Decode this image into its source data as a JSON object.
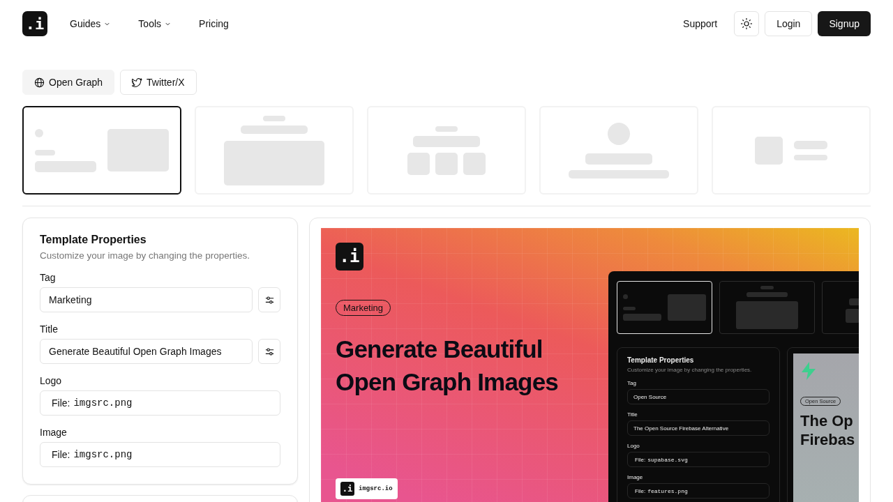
{
  "nav": {
    "logo": ".i",
    "menu": [
      {
        "label": "Guides",
        "dropdown": true
      },
      {
        "label": "Tools",
        "dropdown": true
      },
      {
        "label": "Pricing",
        "dropdown": false
      }
    ],
    "support": "Support",
    "login": "Login",
    "signup": "Signup"
  },
  "format_tabs": [
    {
      "label": "Open Graph",
      "selected": true
    },
    {
      "label": "Twitter/X",
      "selected": false
    }
  ],
  "templates": [
    {
      "kind": "split",
      "selected": true
    },
    {
      "kind": "centered",
      "selected": false
    },
    {
      "kind": "grid",
      "selected": false
    },
    {
      "kind": "profile",
      "selected": false
    },
    {
      "kind": "compact",
      "selected": false
    }
  ],
  "properties": {
    "title": "Template Properties",
    "subtitle": "Customize your image by changing the properties.",
    "fields": [
      {
        "label": "Tag",
        "kind": "text",
        "value": "Marketing"
      },
      {
        "label": "Title",
        "kind": "text",
        "value": "Generate Beautiful Open Graph Images"
      },
      {
        "label": "Logo",
        "kind": "file",
        "prefix": "File:",
        "value": "imgsrc.png"
      },
      {
        "label": "Image",
        "kind": "file",
        "prefix": "File:",
        "value": "imgsrc.png"
      }
    ]
  },
  "preview": {
    "logo": ".i",
    "tag": "Marketing",
    "title": "Generate Beautiful Open Graph Images",
    "badge_logo": ".i",
    "badge_text": "imgsrc.io",
    "screenshot": {
      "templates": [
        {
          "kind": "split",
          "selected": true
        },
        {
          "kind": "centered",
          "selected": false
        },
        {
          "kind": "grid",
          "selected": false
        }
      ],
      "properties": {
        "title": "Template Properties",
        "subtitle": "Customize your image by changing the properties.",
        "fields": [
          {
            "label": "Tag",
            "kind": "text",
            "value": "Open Source"
          },
          {
            "label": "Title",
            "kind": "text",
            "value": "The Open Source Firebase Alternative"
          },
          {
            "label": "Logo",
            "kind": "file",
            "prefix": "File:",
            "value": "supabase.svg"
          },
          {
            "label": "Image",
            "kind": "file",
            "prefix": "File:",
            "value": "features.png"
          }
        ]
      },
      "preview": {
        "tag": "Open Source",
        "title_lines": [
          "The Op",
          "Firebas"
        ]
      }
    }
  }
}
